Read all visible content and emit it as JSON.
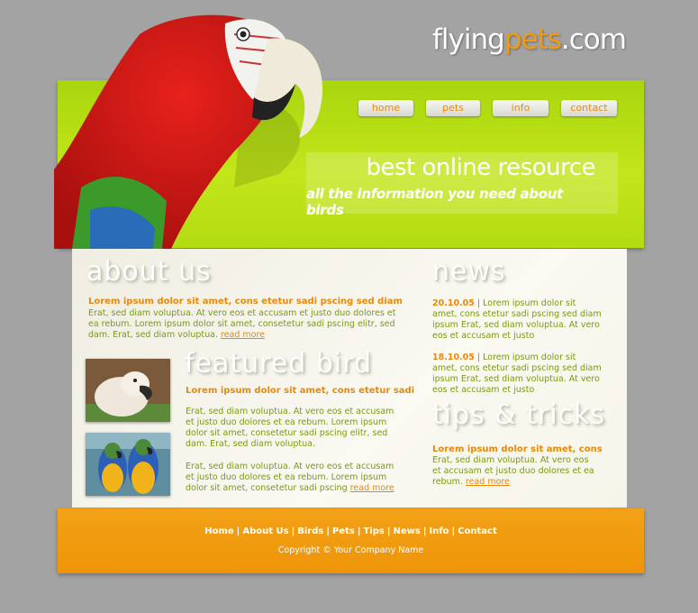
{
  "logo": {
    "part1": "flying",
    "part2": "pets",
    "part3": ".com"
  },
  "nav": [
    "home",
    "pets",
    "info",
    "contact"
  ],
  "banner": {
    "headline": "best online resource",
    "subline": "all the information  you need about birds"
  },
  "about": {
    "title": "about us",
    "lead": "Lorem ipsum dolor sit amet, cons etetur sadi pscing sed diam",
    "text": "Erat, sed diam voluptua. At vero eos et accusam et justo duo dolores et ea rebum. Lorem ipsum dolor sit amet, consetetur sadi pscing elitr, sed dam. Erat, sed diam voluptua.",
    "more": "read more"
  },
  "featured": {
    "title": "featured bird",
    "lead": "Lorem ipsum dolor sit amet, cons etetur sadi",
    "p1": "Erat, sed diam voluptua. At vero eos et accusam et justo duo dolores et ea rebum. Lorem ipsum dolor sit amet, consetetur sadi pscing elitr, sed dam. Erat, sed diam voluptua.",
    "p2": "Erat, sed diam voluptua. At vero eos et accusam et justo duo dolores et ea rebum. Lorem ipsum dolor sit amet, consetetur sadi pscing",
    "more": "read more"
  },
  "news": {
    "title": "news",
    "items": [
      {
        "date": "20.10.05",
        "text": " | Lorem ipsum dolor sit amet, cons etetur sadi pscing sed diam ipsum Erat, sed diam voluptua. At vero eos et accusam et justo"
      },
      {
        "date": "18.10.05",
        "text": " | Lorem ipsum dolor sit amet, cons etetur sadi pscing sed diam ipsum Erat, sed diam voluptua. At vero eos et accusam et justo"
      }
    ]
  },
  "tips": {
    "title": "tips & tricks",
    "lead": "Lorem ipsum dolor sit amet, cons",
    "text": "Erat, sed diam voluptua. At vero eos et accusam et justo duo dolores et ea rebum.",
    "more": "read more"
  },
  "footer": {
    "links": [
      "Home",
      "About Us",
      "Birds",
      "Pets",
      "Tips",
      "News",
      "Info",
      "Contact"
    ],
    "copyright": "Copyright © Your Company Name"
  },
  "colors": {
    "accent": "#e8890c",
    "green": "#b3dc12",
    "text_green": "#7a9a12"
  }
}
